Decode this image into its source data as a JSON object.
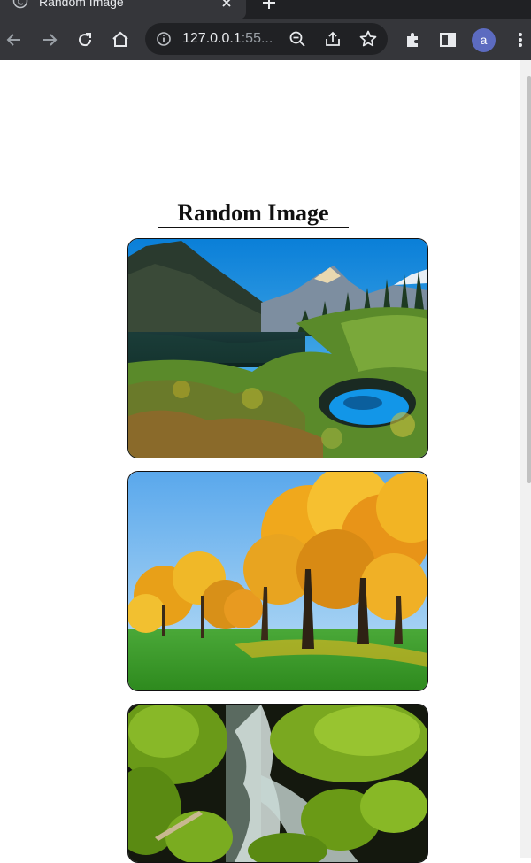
{
  "browser": {
    "tab_title": "Random Image",
    "url_host": "127.0.0.1",
    "url_rest": ":55...",
    "avatar_letter": "a"
  },
  "page": {
    "heading": "Random Image",
    "images": [
      {
        "subject": "mountain-lake-landscape"
      },
      {
        "subject": "autumn-trees-meadow"
      },
      {
        "subject": "mossy-stream"
      }
    ]
  },
  "colors": {
    "chrome_dark": "#202124",
    "chrome_toolbar": "#35363a",
    "avatar": "#5c6bc0"
  }
}
